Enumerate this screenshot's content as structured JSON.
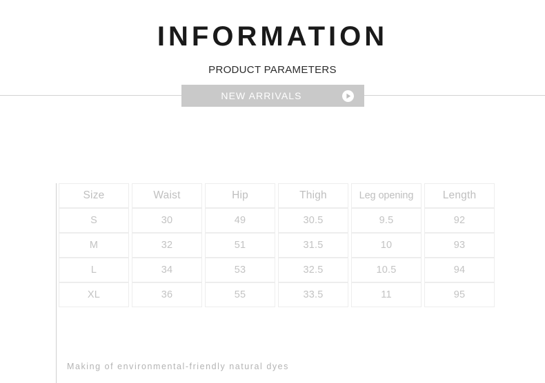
{
  "header": {
    "title": "INFORMATION",
    "subtitle": "PRODUCT PARAMETERS"
  },
  "banner": {
    "label": "NEW ARRIVALS",
    "arrow_icon": "play-circle-icon",
    "background_color": "#c9c9c9",
    "text_color": "#ffffff"
  },
  "divider": {
    "color": "#d2d2d2"
  },
  "size_table": {
    "columns": [
      "Size",
      "Waist",
      "Hip",
      "Thigh",
      "Leg opening",
      "Length"
    ],
    "rows": [
      {
        "size": "S",
        "waist": "30",
        "hip": "49",
        "thigh": "30.5",
        "leg_opening": "9.5",
        "length": "92"
      },
      {
        "size": "M",
        "waist": "32",
        "hip": "51",
        "thigh": "31.5",
        "leg_opening": "10",
        "length": "93"
      },
      {
        "size": "L",
        "waist": "34",
        "hip": "53",
        "thigh": "32.5",
        "leg_opening": "10.5",
        "length": "94"
      },
      {
        "size": "XL",
        "waist": "36",
        "hip": "55",
        "thigh": "33.5",
        "leg_opening": "11",
        "length": "95"
      }
    ],
    "border_color": "#ededed",
    "text_color": "#c3c3c3"
  },
  "footer": {
    "note": "Making of environmental-friendly natural dyes"
  }
}
